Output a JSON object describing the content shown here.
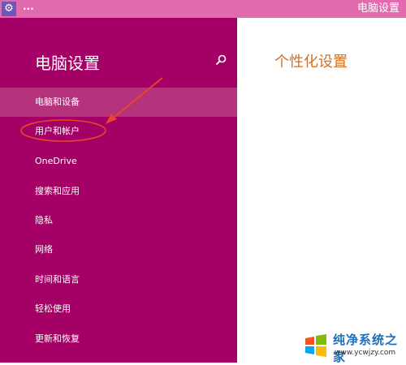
{
  "titlebar": {
    "app_icon_glyph": "⚙",
    "menu_dots": "...",
    "title": "电脑设置"
  },
  "sidebar": {
    "title": "电脑设置",
    "search_icon": "search-icon",
    "items": [
      {
        "label": "电脑和设备",
        "selected": true
      },
      {
        "label": "用户和帐户",
        "selected": false
      },
      {
        "label": "OneDrive",
        "selected": false
      },
      {
        "label": "搜索和应用",
        "selected": false
      },
      {
        "label": "隐私",
        "selected": false
      },
      {
        "label": "网络",
        "selected": false
      },
      {
        "label": "时间和语言",
        "selected": false
      },
      {
        "label": "轻松使用",
        "selected": false
      },
      {
        "label": "更新和恢复",
        "selected": false
      }
    ]
  },
  "main": {
    "title": "个性化设置"
  },
  "colors": {
    "titlebar": "#e26bb0",
    "sidebar": "#a50065",
    "selected_item": "#b5327c",
    "heading_accent": "#d0702a",
    "annotation": "#e8452c"
  },
  "watermark": {
    "name": "纯净系统之家",
    "url": "www.ycwjzy.com"
  }
}
